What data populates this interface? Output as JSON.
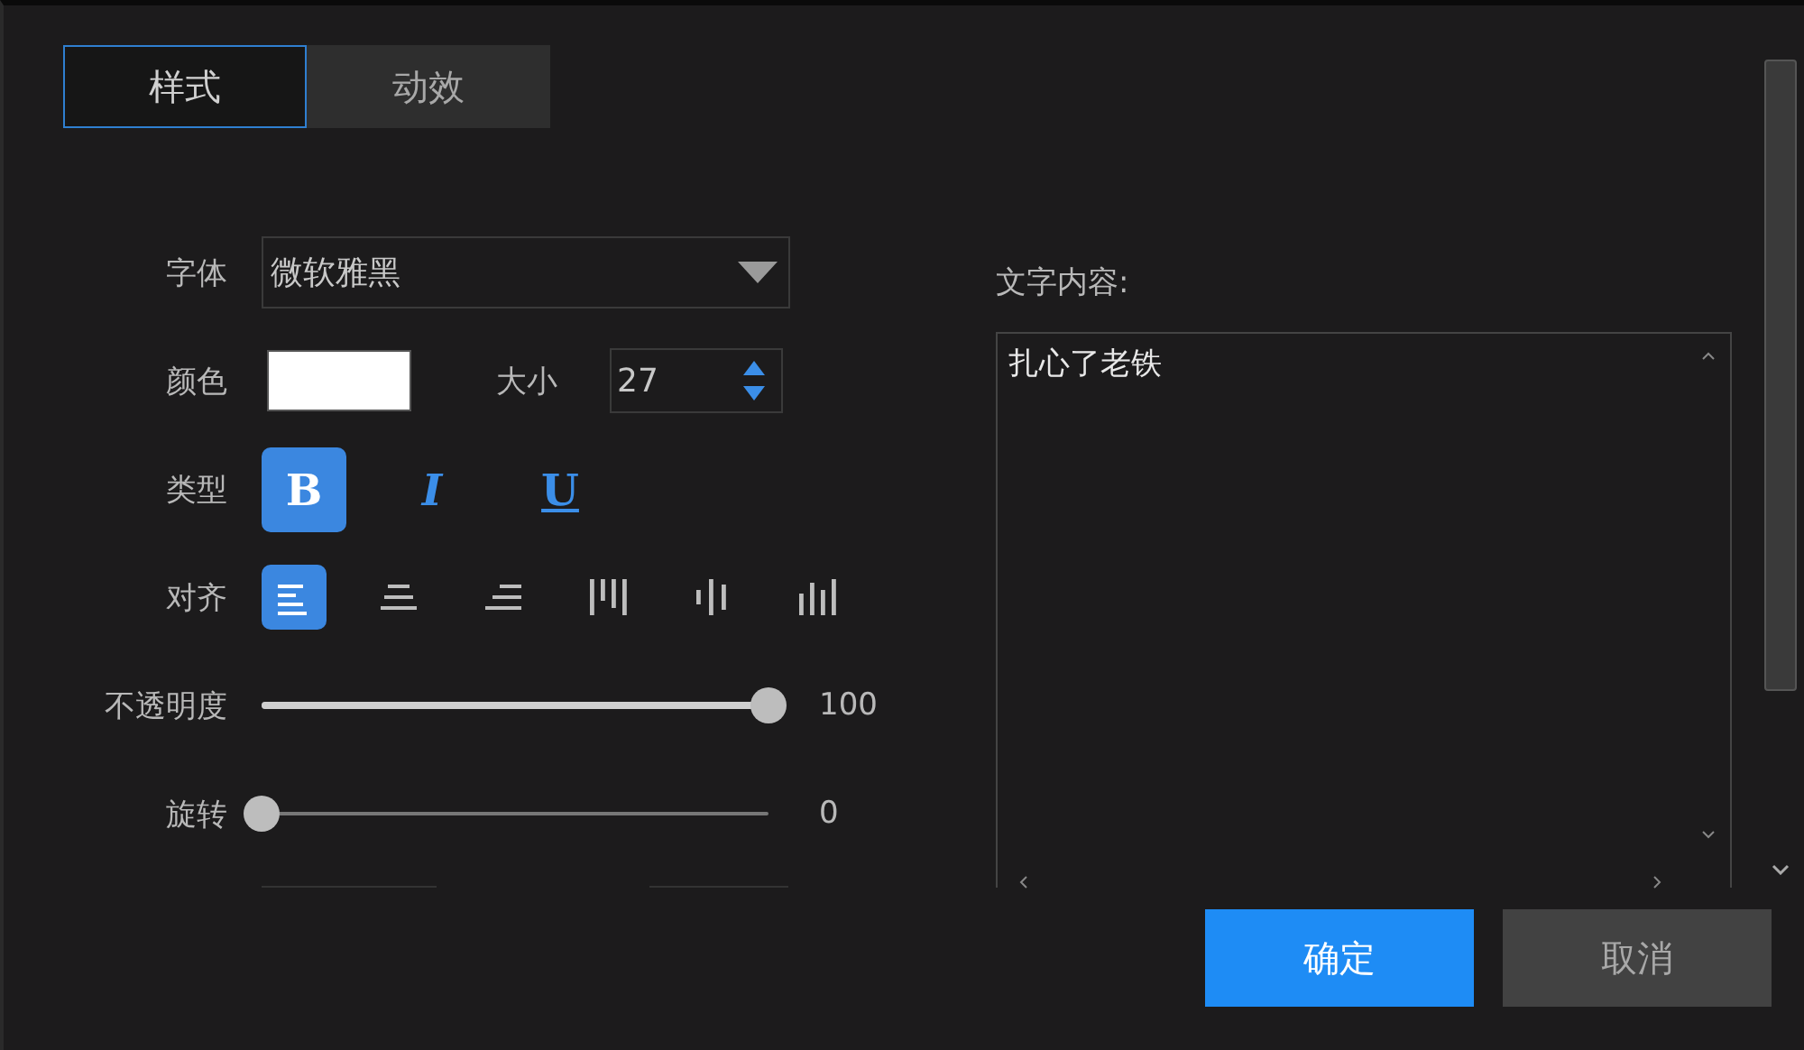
{
  "tabs": [
    {
      "label": "样式",
      "selected": true
    },
    {
      "label": "动效",
      "selected": false
    }
  ],
  "font": {
    "label": "字体",
    "value": "微软雅黑"
  },
  "color": {
    "label": "颜色",
    "color": "#ffffff"
  },
  "size": {
    "label": "大小",
    "value": "27"
  },
  "style": {
    "label": "类型",
    "buttons": [
      {
        "kind": "bold",
        "text": "B",
        "selected": true
      },
      {
        "kind": "italic",
        "text": "I",
        "selected": false
      },
      {
        "kind": "underline",
        "text": "U",
        "selected": false
      }
    ]
  },
  "align": {
    "label": "对齐",
    "options": [
      {
        "kind": "left",
        "selected": true
      },
      {
        "kind": "center",
        "selected": false
      },
      {
        "kind": "right",
        "selected": false
      },
      {
        "kind": "top",
        "selected": false
      },
      {
        "kind": "middle",
        "selected": false
      },
      {
        "kind": "bottom",
        "selected": false
      }
    ]
  },
  "opacity": {
    "label": "不透明度",
    "level": 1,
    "reading": "100"
  },
  "rotation": {
    "label": "旋转",
    "level": 0,
    "reading": "0"
  },
  "content": {
    "label": "文字内容:",
    "value": "扎心了老铁"
  },
  "buttons": [
    {
      "kind": "primary",
      "label": "确定"
    },
    {
      "kind": "secondary",
      "label": "取消"
    }
  ]
}
